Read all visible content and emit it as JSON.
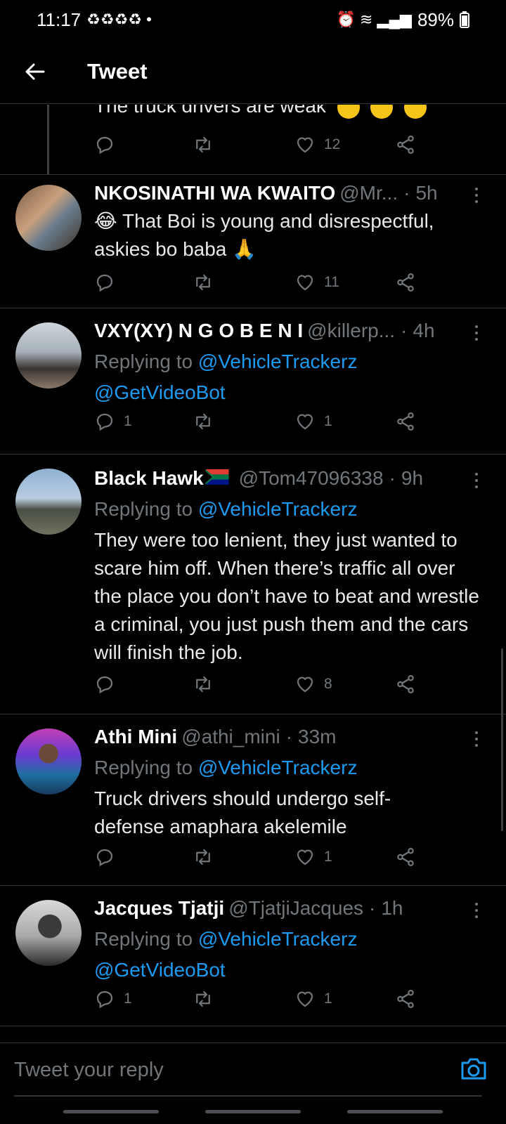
{
  "status_bar": {
    "time": "11:17",
    "battery": "89%"
  },
  "header": {
    "title": "Tweet"
  },
  "previous_tweet": {
    "text": "The truck drivers are weak",
    "likes": "12"
  },
  "tweets": [
    {
      "name": "NKOSINATHI WA KWAITO",
      "handle": "@Mr...",
      "time": "5h",
      "replying_to": "",
      "mentions": [],
      "text": "😂 That Boi is young and disrespectful, askies bo baba 🙏",
      "replies": "",
      "likes": "11"
    },
    {
      "name": "VXY(XY) N G O B E N I",
      "handle": "@killerp...",
      "time": "4h",
      "replying_to": "Replying to",
      "mentions": [
        "@VehicleTrackerz",
        "@GetVideoBot"
      ],
      "text": "",
      "replies": "1",
      "likes": "1"
    },
    {
      "name": "Black Hawk",
      "handle": "@Tom47096338",
      "time": "9h",
      "replying_to": "Replying to",
      "mentions": [
        "@VehicleTrackerz"
      ],
      "text": "They were too lenient, they just wanted to scare him off. When there’s traffic all over the place you don’t have to beat and wrestle a criminal, you just push them and the cars will finish the job.",
      "replies": "",
      "likes": "8"
    },
    {
      "name": "Athi Mini",
      "handle": "@athi_mini",
      "time": "33m",
      "replying_to": "Replying to",
      "mentions": [
        "@VehicleTrackerz"
      ],
      "text": "Truck drivers should undergo self-defense amaphara akelemile",
      "replies": "",
      "likes": "1"
    },
    {
      "name": "Jacques Tjatji",
      "handle": "@TjatjiJacques",
      "time": "1h",
      "replying_to": "Replying to",
      "mentions": [
        "@VehicleTrackerz",
        "@GetVideoBot"
      ],
      "text": "",
      "replies": "1",
      "likes": "1"
    }
  ],
  "reply_bar": {
    "placeholder": "Tweet your reply"
  },
  "colors": {
    "background": "#000000",
    "accent": "#1d9bf0",
    "muted": "#71767b",
    "text": "#e7e9ea",
    "divider": "#2f3336"
  },
  "icons": [
    "back-arrow-icon",
    "reply-icon",
    "retweet-icon",
    "like-icon",
    "share-icon",
    "more-icon",
    "camera-icon"
  ]
}
